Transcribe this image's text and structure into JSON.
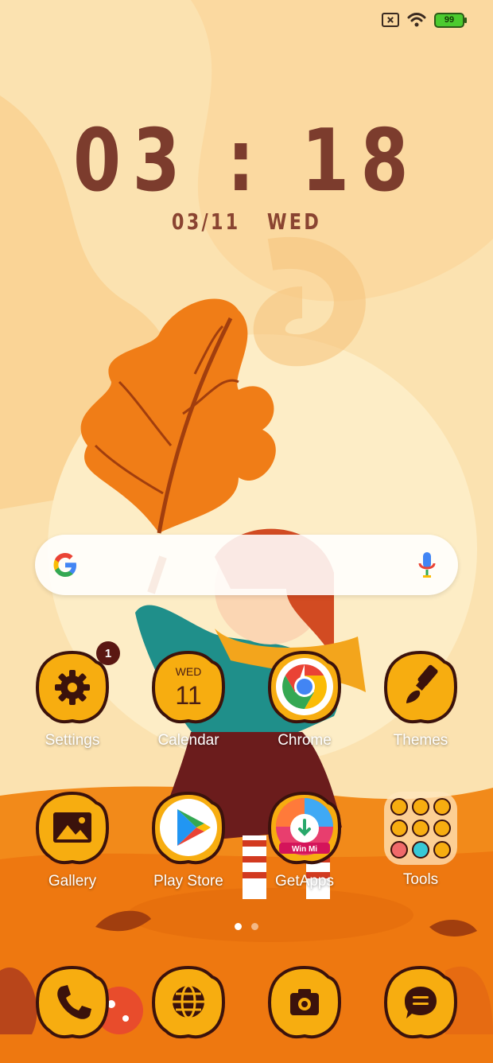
{
  "status_bar": {
    "icons": [
      "no-sim-icon",
      "wifi-icon",
      "battery-icon"
    ],
    "battery_level": "99"
  },
  "clock": {
    "time": "03 : 18"
  },
  "date": {
    "day_month": "03/11",
    "weekday": "WED"
  },
  "search_bar": {
    "icons": [
      "google-g-icon",
      "microphone-icon"
    ]
  },
  "apps_row1": [
    {
      "label": "Settings",
      "icon": "gear-icon",
      "badge": "1"
    },
    {
      "label": "Calendar",
      "icon": "calendar-icon",
      "weekday": "WED",
      "day": "11"
    },
    {
      "label": "Chrome",
      "icon": "chrome-icon"
    },
    {
      "label": "Themes",
      "icon": "paintbrush-icon"
    }
  ],
  "apps_row2": [
    {
      "label": "Gallery",
      "icon": "image-icon"
    },
    {
      "label": "Play Store",
      "icon": "play-store-icon"
    },
    {
      "label": "GetApps",
      "icon": "getapps-icon",
      "sublabel": "Win Mi"
    },
    {
      "label": "Tools",
      "icon": "folder-icon"
    }
  ],
  "page_indicator": {
    "pages": 2,
    "current": 1
  },
  "dock": [
    {
      "icon": "phone-icon"
    },
    {
      "icon": "browser-globe-icon"
    },
    {
      "icon": "camera-icon"
    },
    {
      "icon": "messages-icon"
    }
  ],
  "colors": {
    "icon_fill": "#f7ad10",
    "icon_outline": "#3b120c",
    "clock_text": "#7c3c2d",
    "wallpaper_base": "#fbe2b0"
  }
}
